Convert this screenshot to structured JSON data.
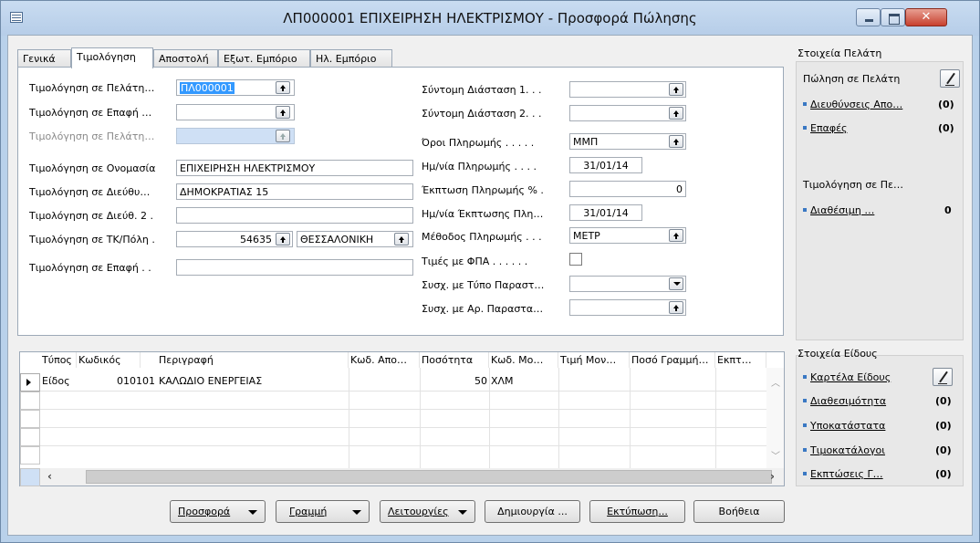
{
  "window": {
    "title": "ΛΠ000001 ΕΠΙΧΕΙΡΗΣΗ ΗΛΕΚΤΡΙΣΜΟΥ - Προσφορά Πώλησης"
  },
  "tabs": [
    "Γενικά",
    "Τιμολόγηση",
    "Αποστολή",
    "Εξωτ. Εμπόριο",
    "Ηλ. Εμπόριο"
  ],
  "active_tab": "Τιμολόγηση",
  "left_fields": {
    "customer_label": "Τιμολόγηση σε Πελάτη…",
    "customer_value": "ΠΛ000001",
    "contact_label": "Τιμολόγηση σε Επαφή …",
    "contact_value": "",
    "customer2_label": "Τιμολόγηση σε Πελάτη…",
    "name_label": "Τιμολόγηση σε Ονομασία",
    "name_value": "ΕΠΙΧΕΙΡΗΣΗ ΗΛΕΚΤΡΙΣΜΟΥ",
    "address_label": "Τιμολόγηση σε Διεύθυ…",
    "address_value": "ΔΗΜΟΚΡΑΤΙΑΣ 15",
    "address2_label": "Τιμολόγηση σε Διεύθ. 2 .",
    "address2_value": "",
    "zip_label": "Τιμολόγηση σε ΤΚ/Πόλη .",
    "zip_value": "54635",
    "city_value": "ΘΕΣΣΑΛΟΝΙΚΗ",
    "contact2_label": "Τιμολόγηση σε Επαφή . .",
    "contact2_value": ""
  },
  "right_fields": {
    "dim1_label": "Σύντομη Διάσταση 1. . .",
    "dim1_value": "",
    "dim2_label": "Σύντομη Διάσταση 2. . .",
    "dim2_value": "",
    "terms_label": "Όροι Πληρωμής . . . . .",
    "terms_value": "ΜΜΠ",
    "paydate_label": "Ημ/νία Πληρωμής . . . .",
    "paydate_value": "31/01/14",
    "discount_label": "Έκπτωση Πληρωμής % .",
    "discount_value": "0",
    "discdate_label": "Ημ/νία Έκπτωσης Πλη…",
    "discdate_value": "31/01/14",
    "method_label": "Μέθοδος Πληρωμής . . .",
    "method_value": "ΜΕΤΡ",
    "vat_label": "Τιμές με ΦΠΑ . . . . . .",
    "doctype_label": "Συσχ. με Τύπο Παραστ…",
    "doctype_value": "",
    "docno_label": "Συσχ. με Αρ. Παραστα…",
    "docno_value": ""
  },
  "customer_panel": {
    "title": "Στοιχεία Πελάτη",
    "sales_label": "Πώληση σε Πελάτη",
    "addresses_label": "Διευθύνσεις Απο…",
    "addresses_count": "(0)",
    "contacts_label": "Επαφές",
    "contacts_count": "(0)",
    "bill_title": "Τιμολόγηση σε Πε…",
    "available_label": "Διαθέσιμη …",
    "available_value": "0"
  },
  "item_panel": {
    "title": "Στοιχεία Είδους",
    "card_label": "Καρτέλα Είδους",
    "availability_label": "Διαθεσιμότητα",
    "availability_count": "(0)",
    "substitutes_label": "Υποκατάστατα",
    "substitutes_count": "(0)",
    "pricelists_label": "Τιμοκατάλογοι",
    "pricelists_count": "(0)",
    "discounts_label": "Εκπτώσεις Γ…",
    "discounts_count": "(0)"
  },
  "grid": {
    "columns": [
      "Τύπος",
      "Κωδικός",
      "Περιγραφή",
      "Κωδ. Απο…",
      "Ποσότητα",
      "Κωδ. Μο…",
      "Τιμή Μον…",
      "Ποσό Γραμμή…",
      "Εκπτ…"
    ],
    "rows": [
      {
        "type": "Είδος",
        "code": "010101",
        "desc": "ΚΑΛΩΔΙΟ ΕΝΕΡΓΕΙΑΣ",
        "loc": "",
        "qty": "50",
        "unit": "ΧΛΜ",
        "price": "",
        "amount": "",
        "disc": ""
      }
    ]
  },
  "buttons": {
    "quote": "Προσφορά",
    "line": "Γραμμή",
    "functions": "Λειτουργίες",
    "create": "Δημιουργία ...",
    "print": "Εκτύπωση...",
    "help": "Βοήθεια"
  }
}
